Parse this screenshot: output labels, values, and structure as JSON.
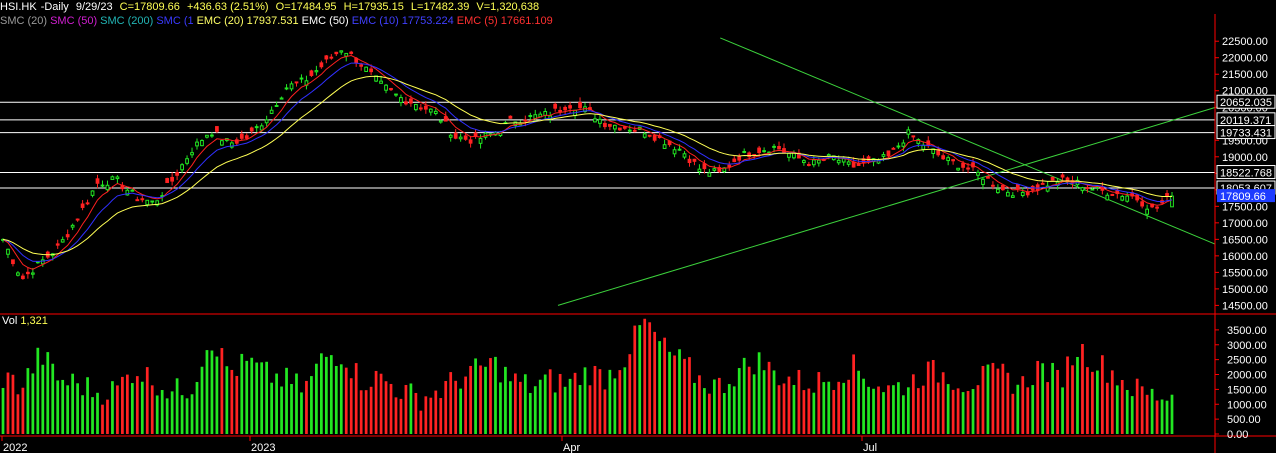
{
  "header": {
    "symbol": "HSI.HK",
    "period": "-Daily",
    "date": "9/29/23",
    "close": "C=17809.66",
    "change": "+436.63 (2.51%)",
    "open": "O=17484.95",
    "high": "H=17935.15",
    "low": "L=17482.39",
    "volume": "V=1,320,638"
  },
  "indicators": [
    {
      "label": "SMC (20)",
      "color": "#9a9a9a"
    },
    {
      "label": "SMC (50)",
      "color": "#d21fd2"
    },
    {
      "label": "SMC (200)",
      "color": "#22b5b5"
    },
    {
      "label": "SMC (1",
      "color": "#3a3aff"
    },
    {
      "label": "EMC (20)",
      "color": "#ffff66"
    },
    {
      "label": "17937.531",
      "color": "#ffff66"
    },
    {
      "label": "EMC (50)",
      "color": "#ffffff"
    },
    {
      "label": "EMC (10)",
      "color": "#4040ff"
    },
    {
      "label": "17753.224",
      "color": "#4040ff"
    },
    {
      "label": "EMC (5)",
      "color": "#ff3030"
    },
    {
      "label": "17661.109",
      "color": "#ff3030"
    }
  ],
  "volume_panel": {
    "label": "Vol",
    "value": "1,321"
  },
  "price_axis": {
    "ticks": [
      "22500.00",
      "22000.00",
      "21500.00",
      "21000.00",
      "20500.00",
      "19500.00",
      "19000.00",
      "18500.00",
      "18000.00",
      "17500.00",
      "17000.00",
      "16500.00",
      "16000.00",
      "15500.00",
      "15000.00",
      "14500.00"
    ],
    "level_labels": [
      "20652.035",
      "20119.371",
      "19733.431",
      "18522.768",
      "18053.607"
    ],
    "current_label": "17809.66"
  },
  "volume_axis": {
    "ticks": [
      "3500.00",
      "3000.00",
      "2500.00",
      "2000.00",
      "1500.00",
      "1000.00",
      "500.00",
      "0.00"
    ]
  },
  "x_labels": [
    "2022",
    "2023",
    "Apr",
    "Jul"
  ],
  "colors": {
    "up": "#22e622",
    "down": "#ff2222",
    "trendline": "#3cd23c",
    "ema5": "#ff2020",
    "ema10": "#3030ff",
    "ema20": "#ffff55",
    "level": "#ffffff",
    "axis": "#ff0000",
    "current_bg": "#1e3cff"
  },
  "chart_data": {
    "type": "candlestick",
    "title": "HSI.HK -Daily",
    "y_range": [
      14300,
      22900
    ],
    "volume_range": [
      0,
      3900
    ],
    "horizontal_levels": [
      20652.035,
      20119.371,
      19733.431,
      18522.768,
      18053.607
    ],
    "last": {
      "date": "9/29/23",
      "open": 17484.95,
      "high": 17935.15,
      "low": 17482.39,
      "close": 17809.66,
      "volume": 1320638
    },
    "ema": {
      "ema20": 17937.531,
      "ema10": 17753.224,
      "ema5": 17661.109
    },
    "closes_weekly": [
      16500,
      15300,
      15800,
      16300,
      17200,
      18200,
      18300,
      17800,
      17600,
      18300,
      19200,
      19800,
      19400,
      19600,
      20200,
      21100,
      21300,
      21800,
      22300,
      21800,
      21200,
      20800,
      20600,
      20300,
      19600,
      19500,
      19700,
      20100,
      20200,
      20300,
      20600,
      20400,
      20000,
      19900,
      19800,
      19500,
      19200,
      18600,
      18500,
      19000,
      19200,
      19300,
      19000,
      18800,
      19000,
      18700,
      18800,
      19000,
      19700,
      19300,
      18900,
      18700,
      18400,
      18000,
      17900,
      18100,
      18300,
      18200,
      18000,
      17900,
      17800,
      17400,
      17800
    ],
    "volumes_weekly": [
      1900,
      1600,
      2700,
      1800,
      1700,
      1400,
      1500,
      2200,
      1800,
      1400,
      1600,
      3300,
      2100,
      2400,
      2000,
      1800,
      1500,
      2600,
      2700,
      1800,
      1900,
      1500,
      1200,
      1400,
      1800,
      2100,
      2400,
      1800,
      1600,
      1800,
      1700,
      2100,
      1900,
      2600,
      3800,
      2900,
      2400,
      1800,
      1600,
      2100,
      2500,
      2000,
      1800,
      1700,
      1900,
      2300,
      1800,
      1500,
      1700,
      2100,
      2000,
      1700,
      1900,
      2000,
      1600,
      2300,
      1800,
      2900,
      2400,
      2000,
      1500,
      1300,
      1300
    ],
    "trendlines": [
      {
        "from_date": "2022-10-31",
        "from_price": 14500,
        "to_date": "2023-09-29",
        "to_price": 20100
      },
      {
        "from_date": "2023-01-27",
        "from_price": 22600,
        "to_date": "2023-09-29",
        "to_price": 16900
      }
    ]
  }
}
